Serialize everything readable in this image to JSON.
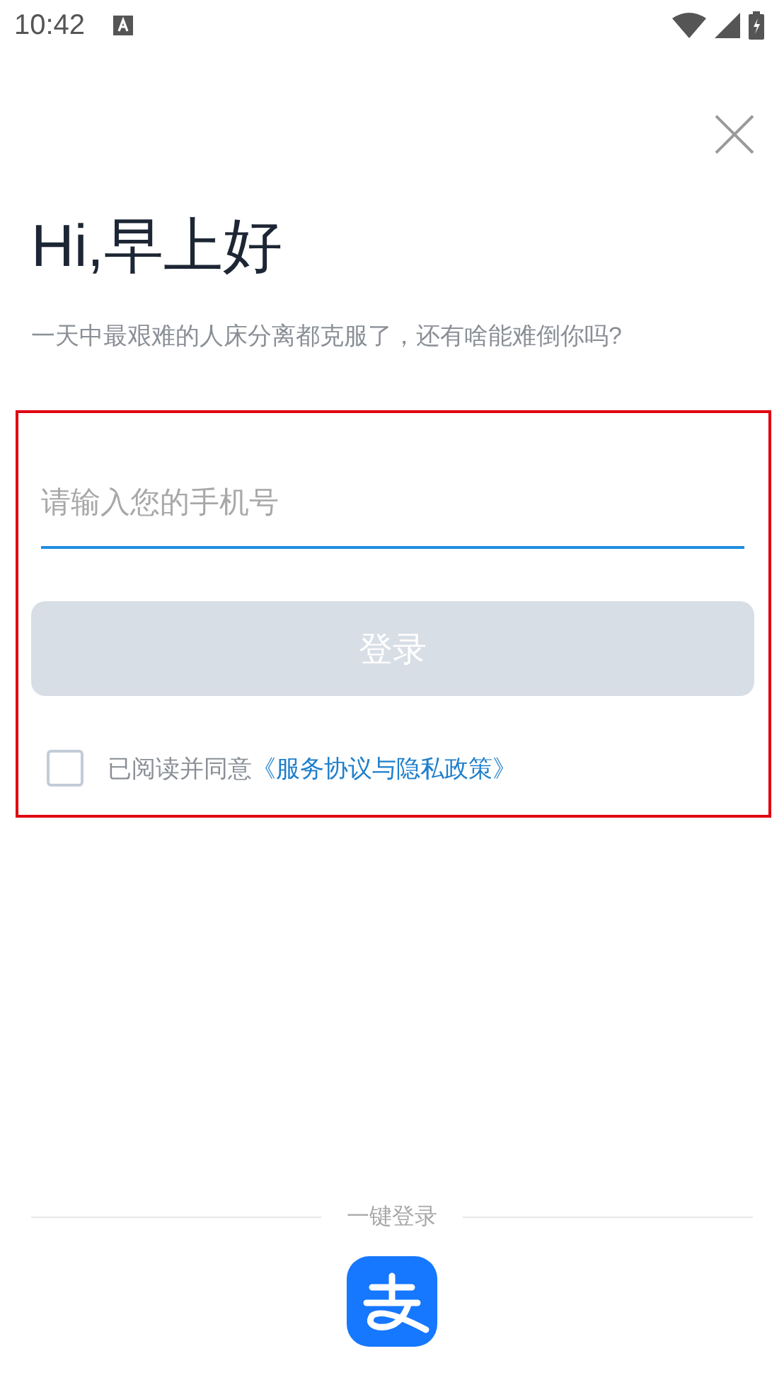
{
  "status_bar": {
    "time": "10:42"
  },
  "title": "Hi,早上好",
  "subtitle": "一天中最艰难的人床分离都克服了，还有啥能难倒你吗?",
  "phone_field": {
    "placeholder": "请输入您的手机号"
  },
  "login_button": {
    "label": "登录",
    "disabled": true
  },
  "agreement": {
    "checked": false,
    "text": "已阅读并同意",
    "link": "《服务协议与隐私政策》"
  },
  "quick_login": {
    "label": "一键登录"
  }
}
